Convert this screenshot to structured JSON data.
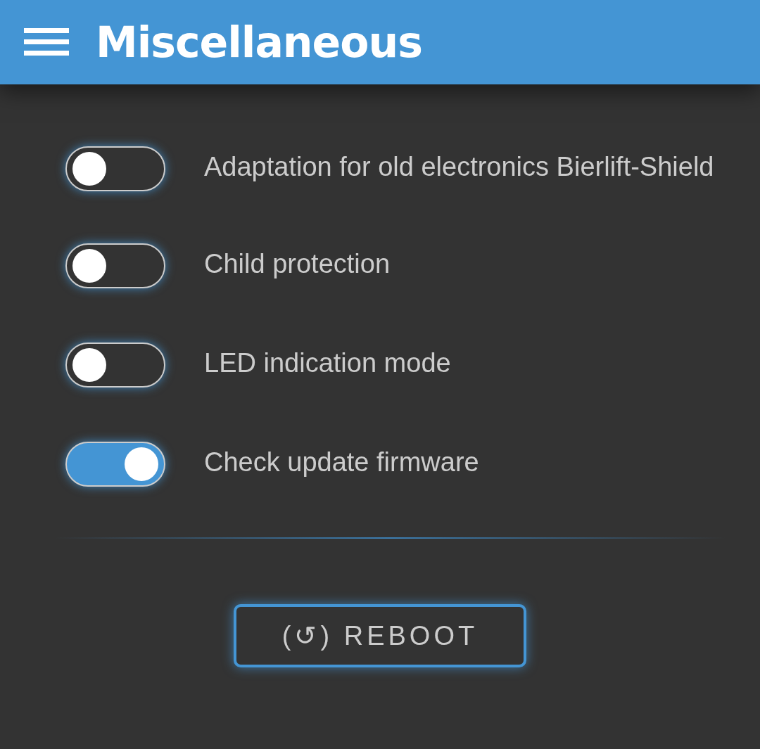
{
  "header": {
    "title": "Miscellaneous"
  },
  "settings": [
    {
      "label": "Adaptation for old electronics Bierlift-Shield",
      "on": false
    },
    {
      "label": "Child protection",
      "on": false
    },
    {
      "label": "LED indication mode",
      "on": false
    },
    {
      "label": "Check update firmware",
      "on": true
    }
  ],
  "buttons": [
    {
      "label": "(↺) REBOOT"
    }
  ]
}
